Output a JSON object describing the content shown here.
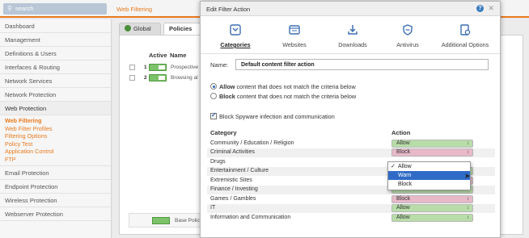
{
  "search": {
    "icon": "search-icon",
    "placeholder": "search"
  },
  "breadcrumb": "Web Filtering",
  "sidebar": {
    "items": [
      {
        "label": "Dashboard"
      },
      {
        "label": "Management"
      },
      {
        "label": "Definitions & Users"
      },
      {
        "label": "Interfaces & Routing"
      },
      {
        "label": "Network Services"
      },
      {
        "label": "Network Protection"
      },
      {
        "label": "Web Protection"
      }
    ],
    "sub_items": [
      {
        "label": "Web Filtering",
        "active": true
      },
      {
        "label": "Web Filter Profiles"
      },
      {
        "label": "Filtering Options"
      },
      {
        "label": "Policy Test"
      },
      {
        "label": "Application Control"
      },
      {
        "label": "FTP"
      }
    ],
    "items_after": [
      {
        "label": "Email Protection"
      },
      {
        "label": "Endpoint Protection"
      },
      {
        "label": "Wireless Protection"
      },
      {
        "label": "Webserver Protection"
      }
    ]
  },
  "main": {
    "tabs": [
      {
        "label": "Global"
      },
      {
        "label": "Policies"
      }
    ],
    "policy_header": {
      "active": "Active",
      "name": "Name"
    },
    "policies": [
      {
        "num": "1",
        "name": "Prospective"
      },
      {
        "num": "2",
        "name": "Browsing al"
      }
    ],
    "base_policy": "Base Policy"
  },
  "dialog": {
    "title": "Edit Filter Action",
    "help_icon": "help-icon",
    "close_icon": "close-icon",
    "tabs": [
      {
        "label": "Categories",
        "icon": "categories-icon",
        "active": true
      },
      {
        "label": "Websites",
        "icon": "websites-icon"
      },
      {
        "label": "Downloads",
        "icon": "downloads-icon"
      },
      {
        "label": "Antivirus",
        "icon": "antivirus-icon"
      },
      {
        "label": "Additional Options",
        "icon": "additional-options-icon"
      }
    ],
    "name_label": "Name:",
    "name_value": "Default content filter action",
    "radio_allow_bold": "Allow",
    "radio_allow_rest": " content that does not match the criteria below",
    "radio_block_bold": "Block",
    "radio_block_rest": " content that does not match the criteria below",
    "spyware_label": "Block Spyware infection and communication",
    "col_category": "Category",
    "col_action": "Action",
    "rows": [
      {
        "category": "Community / Education / Religion",
        "action": "Allow"
      },
      {
        "category": "Criminal Activities",
        "action": "Block"
      },
      {
        "category": "Drugs",
        "action": "Allow"
      },
      {
        "category": "Entertainment / Culture",
        "action": "Allow"
      },
      {
        "category": "Extremistic Sites",
        "action": "Block"
      },
      {
        "category": "Finance / Investing",
        "action": "Allow"
      },
      {
        "category": "Games / Gambles",
        "action": "Block"
      },
      {
        "category": "IT",
        "action": "Allow"
      },
      {
        "category": "Information and Communication",
        "action": "Allow"
      }
    ],
    "dropdown": {
      "options": [
        {
          "label": "Allow",
          "checked": true
        },
        {
          "label": "Warn",
          "highlighted": true
        },
        {
          "label": "Block"
        }
      ]
    }
  },
  "colors": {
    "accent": "#e87a1e",
    "allow": "#b8dda8",
    "block": "#e7b9c9",
    "highlight": "#2f6bc6"
  }
}
